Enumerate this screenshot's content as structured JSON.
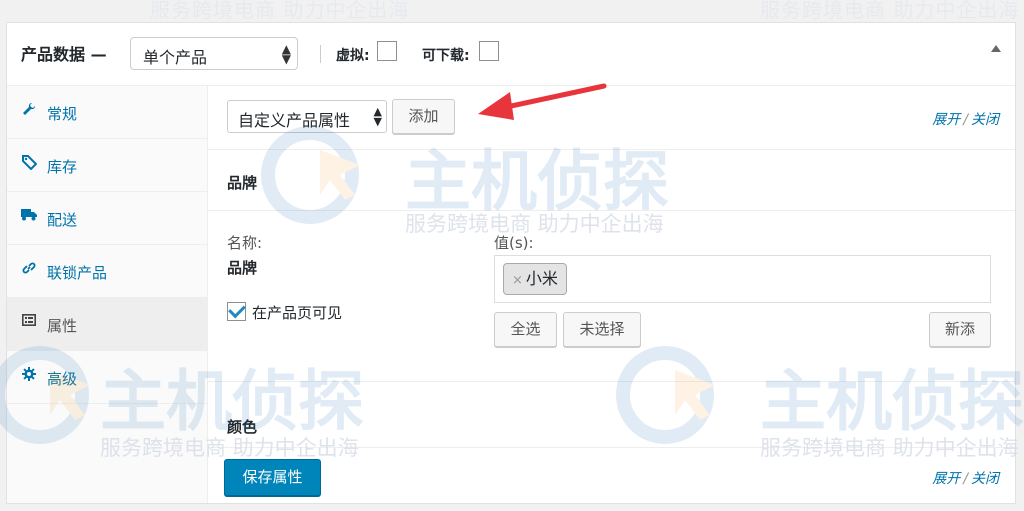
{
  "watermark": {
    "tagline": "服务跨境电商 助力中企出海",
    "brand": "主机侦探"
  },
  "header": {
    "title": "产品数据 —",
    "product_type": "单个产品",
    "virtual_label": "虚拟:",
    "downloadable_label": "可下载:"
  },
  "tabs": [
    {
      "label": "常规",
      "icon": "wrench-icon"
    },
    {
      "label": "库存",
      "icon": "tag-icon"
    },
    {
      "label": "配送",
      "icon": "truck-icon"
    },
    {
      "label": "联锁产品",
      "icon": "link-icon"
    },
    {
      "label": "属性",
      "icon": "list-icon"
    },
    {
      "label": "高级",
      "icon": "gear-icon"
    }
  ],
  "toolbar": {
    "attribute_select": "自定义产品属性",
    "add_label": "添加",
    "expand_label": "展开",
    "separator": "/",
    "close_label": "关闭"
  },
  "attributes": [
    {
      "title": "品牌",
      "name_label": "名称:",
      "name_value": "品牌",
      "visible_label": "在产品页可见",
      "values_label": "值(s):",
      "values": [
        "小米"
      ],
      "remove_symbol": "×",
      "select_all_label": "全选",
      "select_none_label": "未选择",
      "add_new_label": "新添"
    },
    {
      "title": "颜色"
    }
  ],
  "footer": {
    "save_label": "保存属性",
    "expand_label": "展开",
    "separator": "/",
    "close_label": "关闭"
  },
  "colors": {
    "accent": "#0073aa",
    "primary_button": "#0085ba",
    "annotation_arrow": "#e8343b"
  }
}
